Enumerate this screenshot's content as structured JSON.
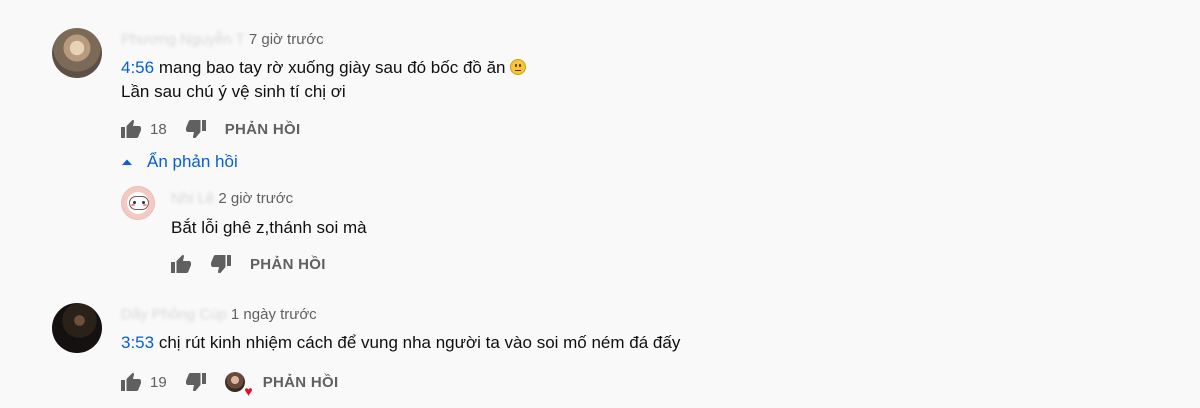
{
  "comments": [
    {
      "time": "7 giờ trước",
      "timestamp_link": "4:56",
      "text_line1": "mang bao tay rờ xuống giày sau đó bốc đồ ăn",
      "text_line2": "Lần sau chú ý vệ sinh tí chị ơi",
      "likes": "18",
      "reply_label": "PHẢN HỒI",
      "hide_replies_label": "Ẩn phản hồi",
      "author_blurred": "Phương Nguyễn T"
    },
    {
      "time": "2 giờ trước",
      "text": "Bắt lỗi ghê z,thánh soi mà",
      "reply_label": "PHẢN HỒI",
      "author_blurred": "Nhi Lê"
    },
    {
      "time": "1 ngày trước",
      "timestamp_link": "3:53",
      "text": "chị rút kinh nhiệm cách để vung nha người ta vào soi mố ném đá đấy",
      "likes": "19",
      "reply_label": "PHẢN HỒI",
      "author_blurred": "Dây Phông Cúp"
    }
  ],
  "icons": {
    "like": "thumb-up-icon",
    "dislike": "thumb-down-icon",
    "collapse": "caret-up-icon",
    "creator_heart": "heart-icon"
  },
  "colors": {
    "link": "#065fd4",
    "secondary_text": "#606060",
    "background": "#f9f9f9",
    "heart": "#e0122a"
  }
}
